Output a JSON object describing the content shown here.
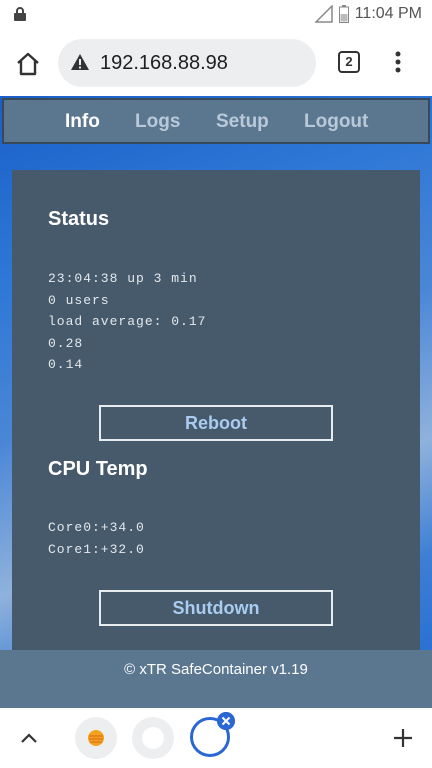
{
  "status_bar": {
    "time": "11:04 PM"
  },
  "browser": {
    "url": "192.168.88.98",
    "tab_count": "2"
  },
  "nav": {
    "items": [
      {
        "label": "Info",
        "active": true
      },
      {
        "label": "Logs",
        "active": false
      },
      {
        "label": "Setup",
        "active": false
      },
      {
        "label": "Logout",
        "active": false
      }
    ]
  },
  "status_section": {
    "title": "Status",
    "lines": [
      "23:04:38 up 3 min",
      "0 users",
      "load average: 0.17",
      "0.28",
      "0.14"
    ],
    "button_label": "Reboot"
  },
  "cpu_section": {
    "title": "CPU Temp",
    "lines": [
      "Core0:+34.0",
      "Core1:+32.0"
    ],
    "button_label": "Shutdown"
  },
  "footer": {
    "text": "©  xTR SafeContainer v1.19"
  },
  "colors": {
    "panel": "#475a6c",
    "nav": "#5b7790",
    "button_text": "#a9ccf0",
    "accent": "#2a66d4"
  }
}
